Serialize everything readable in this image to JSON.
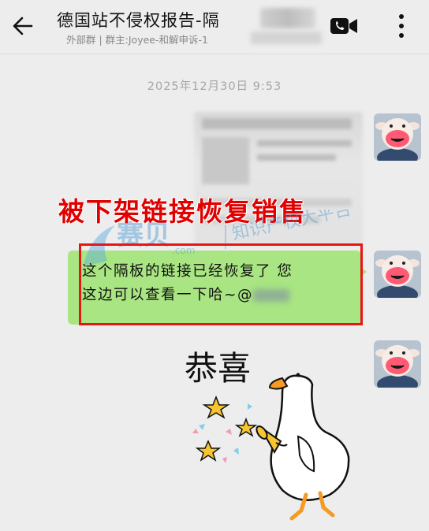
{
  "header": {
    "back_icon": "arrow-left-icon",
    "title": "德国站不侵权报告-隔",
    "subtitle": "外部群 | 群主:Joyee-和解申诉-1",
    "video_icon": "video-call-icon",
    "more_icon": "more-vertical-icon"
  },
  "chat": {
    "timestamp": "2025年12月30日  9:53",
    "caption": "被下架链接恢复销售",
    "message": {
      "line1": "这个隔板的链接已经恢复了 您",
      "line2": "这边可以查看一下哈~@"
    },
    "sticker_text": "恭喜"
  },
  "watermark": {
    "brand": "赛贝",
    "tagline": "知识产权大平台",
    "domain": ".com"
  },
  "colors": {
    "bubble": "#a9e582",
    "highlight": "#e81515",
    "caption": "#e00000",
    "background": "#ededed"
  }
}
